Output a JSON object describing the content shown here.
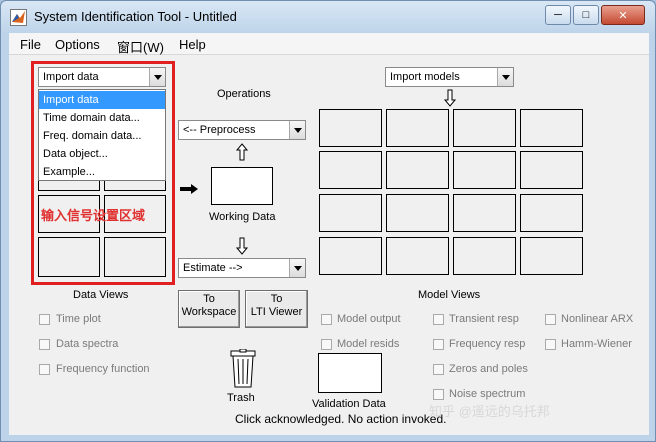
{
  "window": {
    "title": "System Identification Tool - Untitled",
    "buttons": {
      "minimize": "─",
      "maximize": "□",
      "close": "✕"
    }
  },
  "menu": [
    "File",
    "Options",
    "窗口(W)",
    "Help"
  ],
  "import_data": {
    "selected": "Import data",
    "options": [
      "Import data",
      "Time domain data...",
      "Freq. domain data...",
      "Data object...",
      "Example..."
    ]
  },
  "operations": {
    "label": "Operations",
    "preprocess": "<-- Preprocess",
    "working_data": "Working Data",
    "estimate": "Estimate -->"
  },
  "import_models": {
    "selected": "Import models"
  },
  "data_views": {
    "label": "Data Views",
    "items": [
      "Time plot",
      "Data spectra",
      "Frequency function"
    ]
  },
  "buttons": {
    "to_workspace": [
      "To",
      "Workspace"
    ],
    "to_lti_viewer": [
      "To",
      "LTI Viewer"
    ]
  },
  "model_views": {
    "label": "Model Views",
    "col1": [
      "Model output",
      "Model resids"
    ],
    "col2": [
      "Transient resp",
      "Frequency resp",
      "Zeros and poles",
      "Noise spectrum"
    ],
    "col3": [
      "Nonlinear ARX",
      "Hamm-Wiener"
    ]
  },
  "trash": "Trash",
  "validation_data": "Validation Data",
  "status": "Click acknowledged. No action invoked.",
  "annotation": "输入信号设置区域",
  "watermark": "知乎 @遥远的乌托邦",
  "colors": {
    "highlight": "#3399ff",
    "annotation": "#e02020",
    "titlebar": "#bed4ea"
  }
}
